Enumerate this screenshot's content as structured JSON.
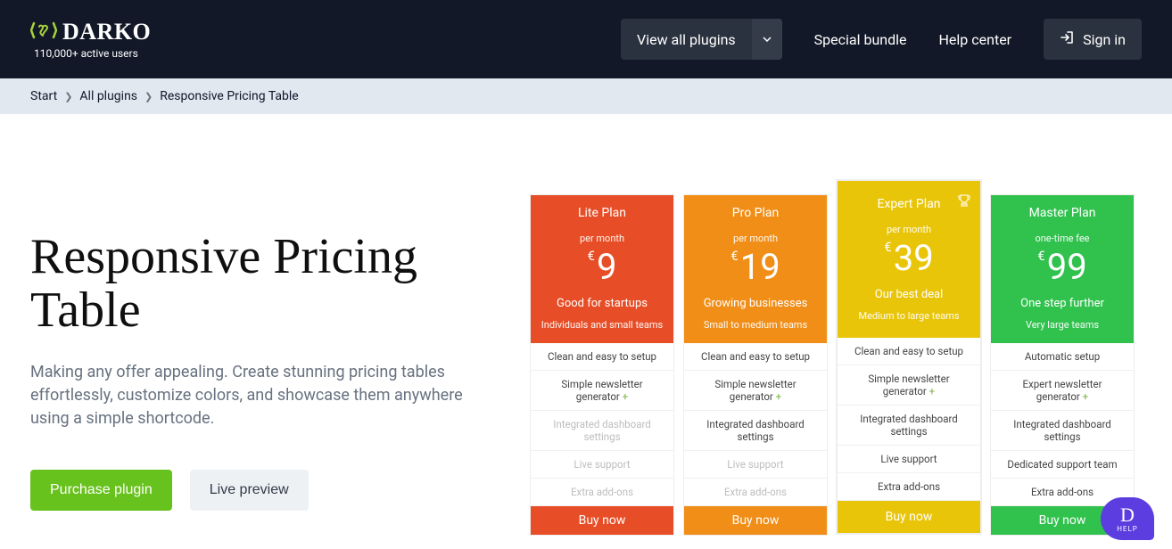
{
  "header": {
    "logo_text": "DARKO",
    "logo_sub": "110,000+ active users",
    "view_plugins": "View all plugins",
    "special": "Special bundle",
    "help": "Help center",
    "signin": "Sign in"
  },
  "crumb": {
    "start": "Start",
    "all": "All plugins",
    "current": "Responsive Pricing Table"
  },
  "hero": {
    "title": "Responsive Pricing Table",
    "desc": "Making any offer appealing. Create stunning pricing tables effortlessly, customize colors, and showcase them anywhere using a simple shortcode.",
    "purchase": "Purchase plugin",
    "preview": "Live preview"
  },
  "plans": [
    {
      "cls": "lite",
      "name": "Lite Plan",
      "period": "per month",
      "currency": "€",
      "price": "9",
      "tag": "Good for startups",
      "aud": "Individuals and small teams",
      "features": [
        {
          "t": "Clean and easy to setup",
          "m": false,
          "p": false
        },
        {
          "t": "Simple newsletter generator",
          "m": false,
          "p": true
        },
        {
          "t": "Integrated dashboard settings",
          "m": true,
          "p": false
        },
        {
          "t": "Live support",
          "m": true,
          "p": false
        },
        {
          "t": "Extra add-ons",
          "m": true,
          "p": false
        }
      ],
      "buy": "Buy now"
    },
    {
      "cls": "pro",
      "name": "Pro Plan",
      "period": "per month",
      "currency": "€",
      "price": "19",
      "tag": "Growing businesses",
      "aud": "Small to medium teams",
      "features": [
        {
          "t": "Clean and easy to setup",
          "m": false,
          "p": false
        },
        {
          "t": "Simple newsletter generator",
          "m": false,
          "p": true
        },
        {
          "t": "Integrated dashboard settings",
          "m": false,
          "p": false
        },
        {
          "t": "Live support",
          "m": true,
          "p": false
        },
        {
          "t": "Extra add-ons",
          "m": true,
          "p": false
        }
      ],
      "buy": "Buy now"
    },
    {
      "cls": "expert",
      "name": "Expert Plan",
      "period": "per month",
      "currency": "€",
      "price": "39",
      "tag": "Our best deal",
      "aud": "Medium to large teams",
      "trophy": true,
      "features": [
        {
          "t": "Clean and easy to setup",
          "m": false,
          "p": false
        },
        {
          "t": "Simple newsletter generator",
          "m": false,
          "p": true
        },
        {
          "t": "Integrated dashboard settings",
          "m": false,
          "p": false
        },
        {
          "t": "Live support",
          "m": false,
          "p": false
        },
        {
          "t": "Extra add-ons",
          "m": false,
          "p": false
        }
      ],
      "buy": "Buy now"
    },
    {
      "cls": "master",
      "name": "Master Plan",
      "period": "one-time fee",
      "currency": "€",
      "price": "99",
      "tag": "One step further",
      "aud": "Very large teams",
      "features": [
        {
          "t": "Automatic setup",
          "m": false,
          "p": false
        },
        {
          "t": "Expert newsletter generator",
          "m": false,
          "p": true
        },
        {
          "t": "Integrated dashboard settings",
          "m": false,
          "p": false
        },
        {
          "t": "Dedicated support team",
          "m": false,
          "p": false
        },
        {
          "t": "Extra add-ons",
          "m": false,
          "p": false
        }
      ],
      "buy": "Buy now"
    }
  ],
  "help_bubble": {
    "letter": "D",
    "label": "HELP"
  }
}
